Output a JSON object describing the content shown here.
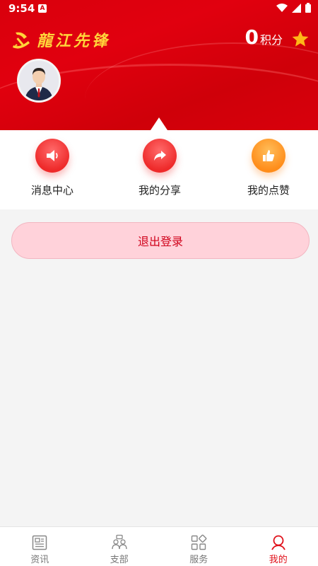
{
  "status_bar": {
    "time": "9:54",
    "badge": "A"
  },
  "header": {
    "app_title": "龍江先锋",
    "points_value": "0",
    "points_unit": "积分"
  },
  "actions": [
    {
      "label": "消息中心",
      "icon": "speaker-icon",
      "color": "#ee2a2a"
    },
    {
      "label": "我的分享",
      "icon": "share-arrow-icon",
      "color": "#ee2a2a"
    },
    {
      "label": "我的点赞",
      "icon": "thumbs-up-icon",
      "color": "#ff8d1a"
    }
  ],
  "logout_label": "退出登录",
  "tabs": [
    {
      "label": "资讯",
      "icon": "newspaper-icon",
      "active": false
    },
    {
      "label": "支部",
      "icon": "group-icon",
      "active": false
    },
    {
      "label": "服务",
      "icon": "grid-icon",
      "active": false
    },
    {
      "label": "我的",
      "icon": "person-icon",
      "active": true
    }
  ],
  "colors": {
    "brand_red": "#d9000c",
    "logo_gold": "#ffd43a",
    "active_tab": "#e0101a",
    "logout_bg": "#ffd2da"
  }
}
